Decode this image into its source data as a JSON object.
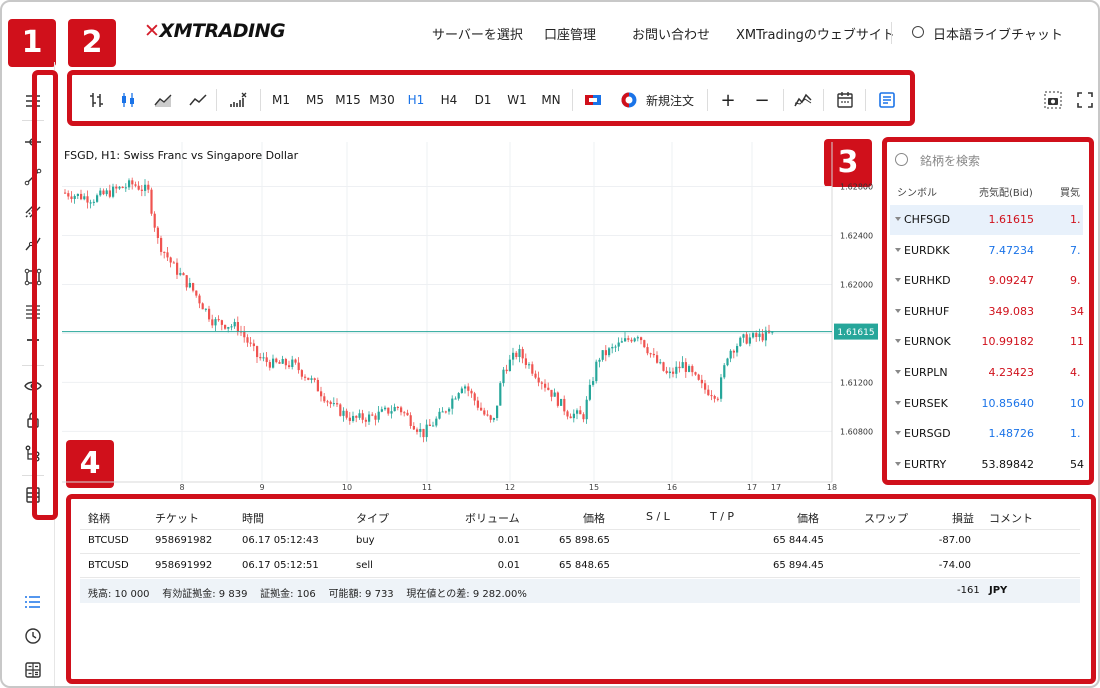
{
  "header": {
    "logo": "XMTRADING",
    "nav": [
      "サーバーを選択",
      "口座管理",
      "お問い合わせ",
      "XMTradingのウェブサイト",
      "日本語ライブチャット"
    ]
  },
  "badges": [
    "1",
    "2",
    "3",
    "4"
  ],
  "toolbar": {
    "timeframes": [
      "M1",
      "M5",
      "M15",
      "M30",
      "H1",
      "H4",
      "D1",
      "W1",
      "MN"
    ],
    "active_timeframe": "H1",
    "new_order": "新規注文",
    "zoom_in": "+",
    "zoom_out": "−"
  },
  "chart": {
    "title": "FSGD, H1: Swiss Franc vs Singapore Dollar",
    "price_ticks": [
      "1.62800",
      "1.62400",
      "1.62000",
      "1.61200",
      "1.60800"
    ],
    "current_price": "1.61615",
    "x_ticks": [
      "8",
      "9",
      "10",
      "11",
      "12",
      "15",
      "16",
      "17",
      "17",
      "18"
    ]
  },
  "market_watch": {
    "search_placeholder": "銘柄を検索",
    "headers": {
      "symbol": "シンボル",
      "bid": "売気配(Bid)",
      "ask": "買気"
    },
    "rows": [
      {
        "symbol": "CHFSGD",
        "bid": "1.61615",
        "ask": "1.",
        "color": "red"
      },
      {
        "symbol": "EURDKK",
        "bid": "7.47234",
        "ask": "7.",
        "color": "blue"
      },
      {
        "symbol": "EURHKD",
        "bid": "9.09247",
        "ask": "9.",
        "color": "red"
      },
      {
        "symbol": "EURHUF",
        "bid": "349.083",
        "ask": "34",
        "color": "red"
      },
      {
        "symbol": "EURNOK",
        "bid": "10.99182",
        "ask": "11.",
        "color": "red"
      },
      {
        "symbol": "EURPLN",
        "bid": "4.23423",
        "ask": "4.",
        "color": "red"
      },
      {
        "symbol": "EURSEK",
        "bid": "10.85640",
        "ask": "10.",
        "color": "blue"
      },
      {
        "symbol": "EURSGD",
        "bid": "1.48726",
        "ask": "1.",
        "color": "blue"
      },
      {
        "symbol": "EURTRY",
        "bid": "53.89842",
        "ask": "54.",
        "color": "black"
      }
    ]
  },
  "trades": {
    "headers": [
      "銘柄",
      "チケット",
      "時間",
      "タイプ",
      "ボリューム",
      "価格",
      "S / L",
      "T / P",
      "価格",
      "スワップ",
      "損益",
      "コメント"
    ],
    "rows": [
      {
        "symbol": "BTCUSD",
        "ticket": "958691982",
        "time": "06.17 05:12:43",
        "type": "buy",
        "volume": "0.01",
        "open_price": "65 898.65",
        "price": "65 844.45",
        "profit": "-87.00"
      },
      {
        "symbol": "BTCUSD",
        "ticket": "958691992",
        "time": "06.17 05:12:51",
        "type": "sell",
        "volume": "0.01",
        "open_price": "65 848.65",
        "price": "65 894.45",
        "profit": "-74.00"
      }
    ],
    "summary": "残高: 10 000    有効証拠金: 9 839    証拠金: 106    可能額: 9 733    現在値との差: 9 282.00%",
    "total_profit": "-161",
    "currency": "JPY"
  },
  "colors": {
    "accent_red": "#d0101b",
    "blue": "#1a73e8",
    "up_candle": "#26a69a",
    "down_candle": "#ef5350"
  }
}
